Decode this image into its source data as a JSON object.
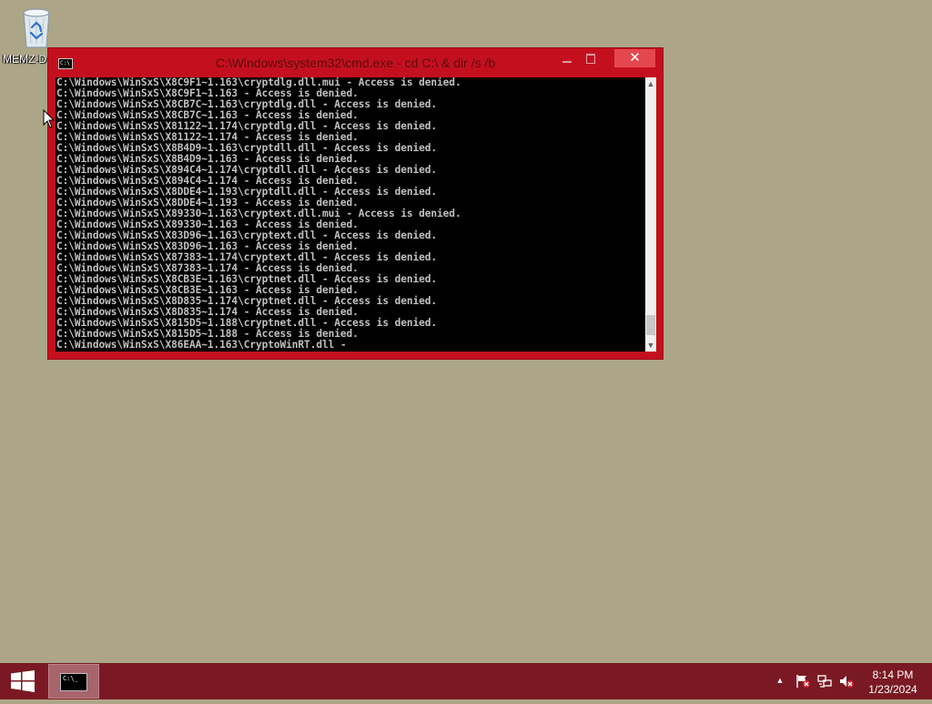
{
  "desktop": {
    "recycle_bin_label": "MEMZ-D"
  },
  "window": {
    "title": "C:\\Windows\\system32\\cmd.exe - cd C:\\ & dir /s /b",
    "close_glyph": "✕",
    "icon_text": "C:\\"
  },
  "console": {
    "lines": [
      "C:\\Windows\\WinSxS\\X8C9F1~1.163\\cryptdlg.dll.mui - Access is denied.",
      "C:\\Windows\\WinSxS\\X8C9F1~1.163 - Access is denied.",
      "C:\\Windows\\WinSxS\\X8CB7C~1.163\\cryptdlg.dll - Access is denied.",
      "C:\\Windows\\WinSxS\\X8CB7C~1.163 - Access is denied.",
      "C:\\Windows\\WinSxS\\X81122~1.174\\cryptdlg.dll - Access is denied.",
      "C:\\Windows\\WinSxS\\X81122~1.174 - Access is denied.",
      "C:\\Windows\\WinSxS\\X8B4D9~1.163\\cryptdll.dll - Access is denied.",
      "C:\\Windows\\WinSxS\\X8B4D9~1.163 - Access is denied.",
      "C:\\Windows\\WinSxS\\X894C4~1.174\\cryptdll.dll - Access is denied.",
      "C:\\Windows\\WinSxS\\X894C4~1.174 - Access is denied.",
      "C:\\Windows\\WinSxS\\X8DDE4~1.193\\cryptdll.dll - Access is denied.",
      "C:\\Windows\\WinSxS\\X8DDE4~1.193 - Access is denied.",
      "C:\\Windows\\WinSxS\\X89330~1.163\\cryptext.dll.mui - Access is denied.",
      "C:\\Windows\\WinSxS\\X89330~1.163 - Access is denied.",
      "C:\\Windows\\WinSxS\\X83D96~1.163\\cryptext.dll - Access is denied.",
      "C:\\Windows\\WinSxS\\X83D96~1.163 - Access is denied.",
      "C:\\Windows\\WinSxS\\X87383~1.174\\cryptext.dll - Access is denied.",
      "C:\\Windows\\WinSxS\\X87383~1.174 - Access is denied.",
      "C:\\Windows\\WinSxS\\X8CB3E~1.163\\cryptnet.dll - Access is denied.",
      "C:\\Windows\\WinSxS\\X8CB3E~1.163 - Access is denied.",
      "C:\\Windows\\WinSxS\\X8D835~1.174\\cryptnet.dll - Access is denied.",
      "C:\\Windows\\WinSxS\\X8D835~1.174 - Access is denied.",
      "C:\\Windows\\WinSxS\\X815D5~1.188\\cryptnet.dll - Access is denied.",
      "C:\\Windows\\WinSxS\\X815D5~1.188 - Access is denied.",
      "C:\\Windows\\WinSxS\\X86EAA~1.163\\CryptoWinRT.dll -"
    ],
    "scroll_up_glyph": "▲",
    "scroll_down_glyph": "▼"
  },
  "taskbar": {
    "cmd_icon_text": "C:\\_",
    "tray_arrow_glyph": "▲",
    "time": "8:14 PM",
    "date": "1/23/2024"
  },
  "colors": {
    "desktop_bg": "#ada587",
    "window_frame": "#c4101e",
    "close_button": "#e5474f",
    "taskbar": "#7a1923"
  }
}
